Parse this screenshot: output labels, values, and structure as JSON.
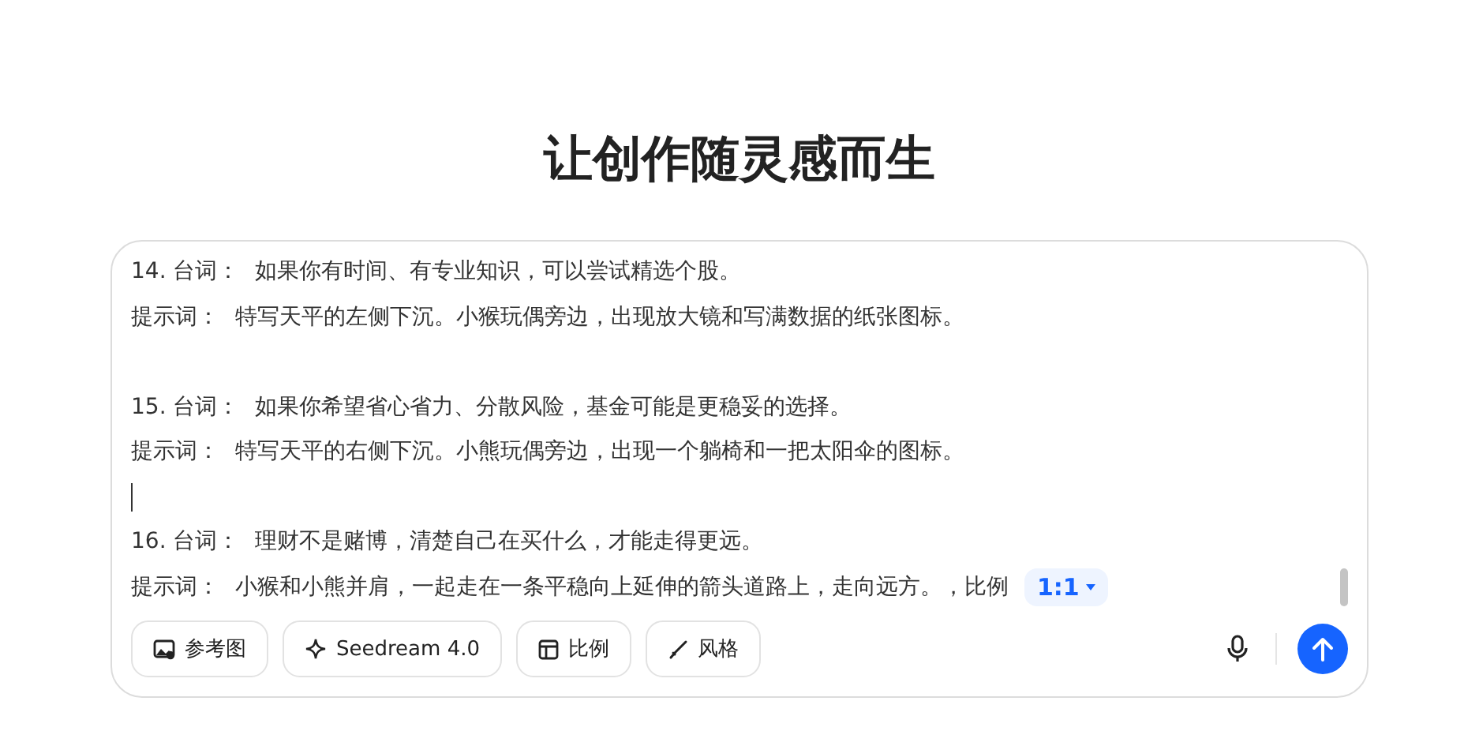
{
  "heading": "让创作随灵感而生",
  "editor": {
    "lines": [
      {
        "kind": "text",
        "label": "14. 台词：",
        "text": "如果你有时间、有专业知识，可以尝试精选个股。"
      },
      {
        "kind": "text",
        "label": "提示词：",
        "text": "特写天平的左侧下沉。小猴玩偶旁边，出现放大镜和写满数据的纸张图标。"
      },
      {
        "kind": "blank"
      },
      {
        "kind": "text",
        "label": "15. 台词：",
        "text": "如果你希望省心省力、分散风险，基金可能是更稳妥的选择。"
      },
      {
        "kind": "text",
        "label": "提示词：",
        "text": "特写天平的右侧下沉。小熊玩偶旁边，出现一个躺椅和一把太阳伞的图标。"
      },
      {
        "kind": "cursor"
      },
      {
        "kind": "text",
        "label": "16. 台词：",
        "text": "理财不是赌博，清楚自己在买什么，才能走得更远。"
      },
      {
        "kind": "text",
        "label": "提示词：",
        "text": "小猴和小熊并肩，一起走在一条平稳向上延伸的箭头道路上，走向远方。，比例",
        "chip": "1:1"
      }
    ]
  },
  "toolbar": [
    {
      "kind": "image",
      "label": "参考图"
    },
    {
      "kind": "sparkle",
      "label": "Seedream 4.0"
    },
    {
      "kind": "ratio",
      "label": "比例"
    },
    {
      "kind": "brush",
      "label": "风格"
    }
  ]
}
